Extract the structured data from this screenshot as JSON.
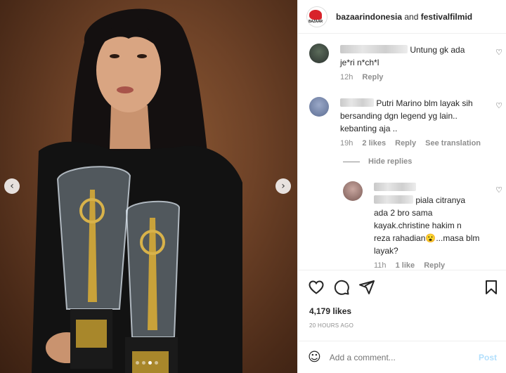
{
  "header": {
    "account1": "bazaarindonesia",
    "and": "and",
    "account2": "festivalfilmid",
    "logo_text": "BAZAAR"
  },
  "comments": [
    {
      "text_line1": "Untung gk ada",
      "text_line2": "je*ri n*ch*l",
      "time": "12h",
      "reply": "Reply"
    },
    {
      "text_line1": "Putri Marino blm layak sih",
      "text_line2": "bersanding dgn legend yg lain..",
      "text_line3": "kebanting aja ..",
      "time": "19h",
      "likes": "2 likes",
      "reply": "Reply",
      "translate": "See translation"
    }
  ],
  "hide_replies": "Hide replies",
  "reply_comment": {
    "text_line1": "piala citranya",
    "text_line2": "ada 2 bro sama",
    "text_line3": "kayak.christine hakim n",
    "text_line4": "reza rahadian",
    "emoji": "😮",
    "text_line4b": "...masa blm",
    "text_line5": "layak?",
    "time": "11h",
    "likes": "1 like",
    "reply": "Reply"
  },
  "post": {
    "likes": "4,179 likes",
    "date": "20 HOURS AGO"
  },
  "comment_box": {
    "placeholder": "Add a comment...",
    "post_label": "Post"
  },
  "carousel": {
    "prev": "‹",
    "next": "›",
    "dots_total": 4,
    "active_index": 2
  }
}
